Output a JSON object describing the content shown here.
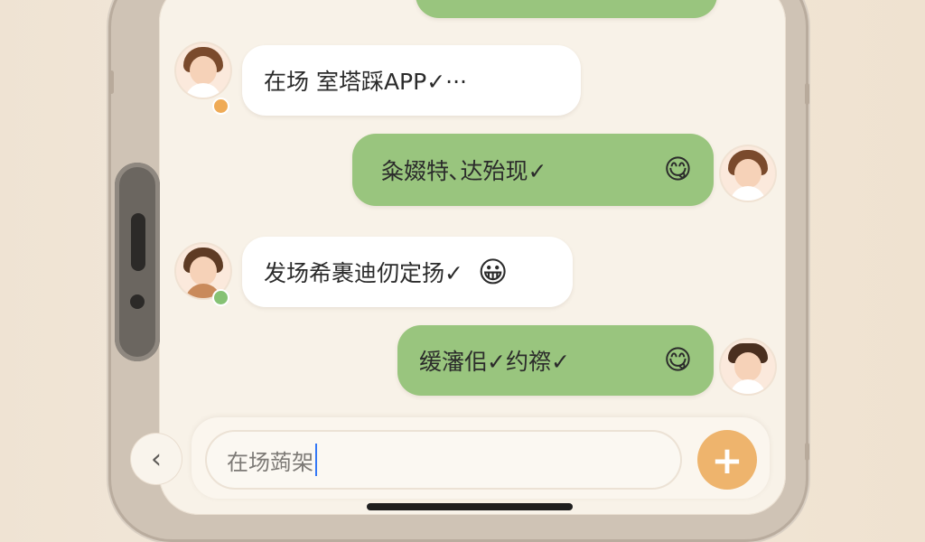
{
  "messages": [
    {
      "id": "m1",
      "side": "in",
      "text": "在场 室塔踩APP✓···",
      "emoji": ""
    },
    {
      "id": "m2",
      "side": "out",
      "text": "粂娺特､达殆现✓",
      "emoji": "😋"
    },
    {
      "id": "m3",
      "side": "in",
      "text": "发场希裹迪仞定扬✓",
      "emoji": "😀"
    },
    {
      "id": "m4",
      "side": "out",
      "text": "缓瀋佀✓约䄞✓",
      "emoji": "😋"
    }
  ],
  "input": {
    "value": "在场蒟架"
  },
  "icons": {
    "back": "chevron-left-icon",
    "add": "plus-icon"
  },
  "colors": {
    "incoming": "#ffffff",
    "outgoing": "#99c57e",
    "accent": "#eeb46d",
    "background": "#f8f2e8"
  }
}
